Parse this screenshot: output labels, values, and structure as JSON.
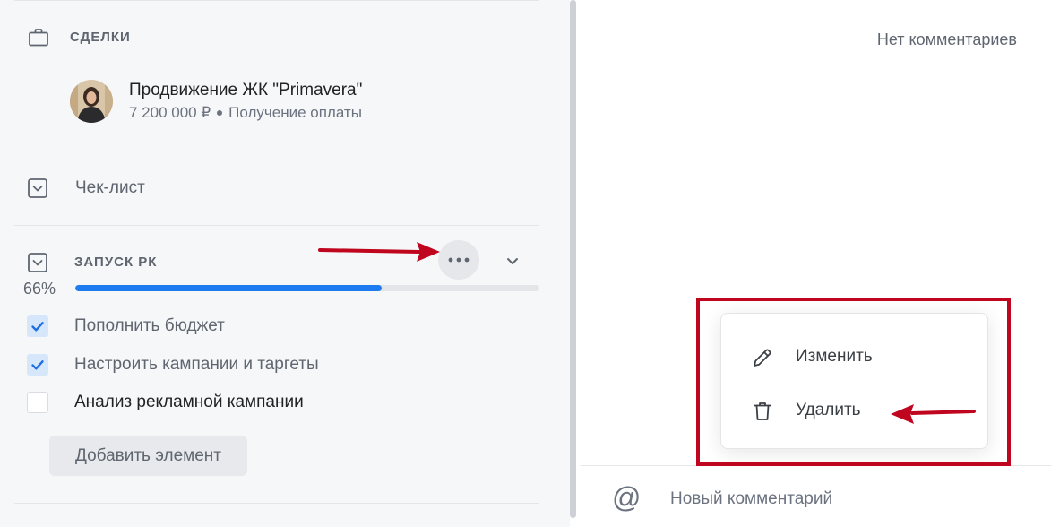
{
  "deals": {
    "heading": "СДЕЛКИ",
    "icon": "briefcase-icon",
    "deal": {
      "title": "Продвижение ЖК \"Primavera\"",
      "amount": "7 200 000 ₽",
      "stage": "Получение оплаты"
    }
  },
  "checklist": {
    "label": "Чек-лист",
    "icon": "checklist-icon"
  },
  "task_group": {
    "title": "ЗАПУСК РК",
    "progress_percent": "66%",
    "progress_value": 0.66,
    "progress_color": "#1f7cf0",
    "items": [
      {
        "label": "Пополнить бюджет",
        "checked": true
      },
      {
        "label": "Настроить кампании и таргеты",
        "checked": true
      },
      {
        "label": "Анализ рекламной кампании",
        "checked": false
      }
    ],
    "add_button": "Добавить элемент"
  },
  "comments": {
    "empty_text": "Нет комментариев",
    "mention_symbol": "@",
    "input_placeholder": "Новый комментарий"
  },
  "context_menu": {
    "edit_label": "Изменить",
    "edit_icon": "pencil-icon",
    "delete_label": "Удалить",
    "delete_icon": "trash-icon"
  },
  "annotation_color": "#c0051e"
}
